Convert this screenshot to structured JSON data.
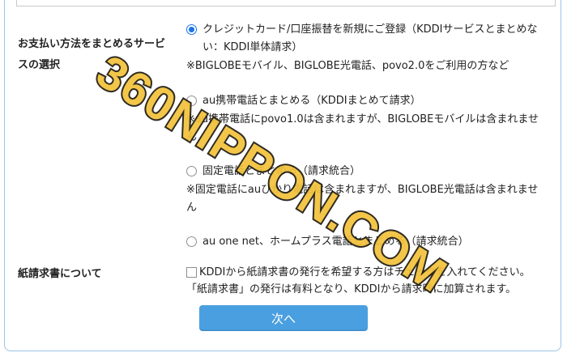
{
  "payment": {
    "label": "お支払い方法をまとめるサービスの選択",
    "options": [
      {
        "label": "クレジットカード/口座振替を新規にご登録（KDDIサービスとまとめない：KDDI単体請求）",
        "note": "※BIGLOBEモバイル、BIGLOBE光電話、povo2.0をご利用の方など",
        "selected": true
      },
      {
        "label": "au携帯電話とまとめる（KDDIまとめて請求）",
        "note": "※au携帯電話にpovo1.0は含まれますが、BIGLOBEモバイルは含まれません",
        "selected": false
      },
      {
        "label": "固定電話とまとめる（請求統合）",
        "note": "※固定電話にauひかり電話は含まれますが、BIGLOBE光電話は含まれません",
        "selected": false
      },
      {
        "label": "au one net、ホームプラス電話とまとめる（請求統合）",
        "note": "",
        "selected": false
      }
    ]
  },
  "paper_invoice": {
    "label": "紙請求書について",
    "checkbox_label": "KDDIから紙請求書の発行を希望する方はチェックを入れてください。",
    "note": "「紙請求書」の発行は有料となり、KDDIから請求時に加算されます。",
    "checked": false
  },
  "next_button": {
    "label": "次へ"
  },
  "watermark": {
    "text": "360NIPPON.COM"
  },
  "colors": {
    "accent": "#1a73e8",
    "button": "#4a9fe0",
    "frame_border": "#9dc3e8",
    "watermark_fill": "#f2c23a",
    "watermark_stroke": "#1e1a10"
  }
}
